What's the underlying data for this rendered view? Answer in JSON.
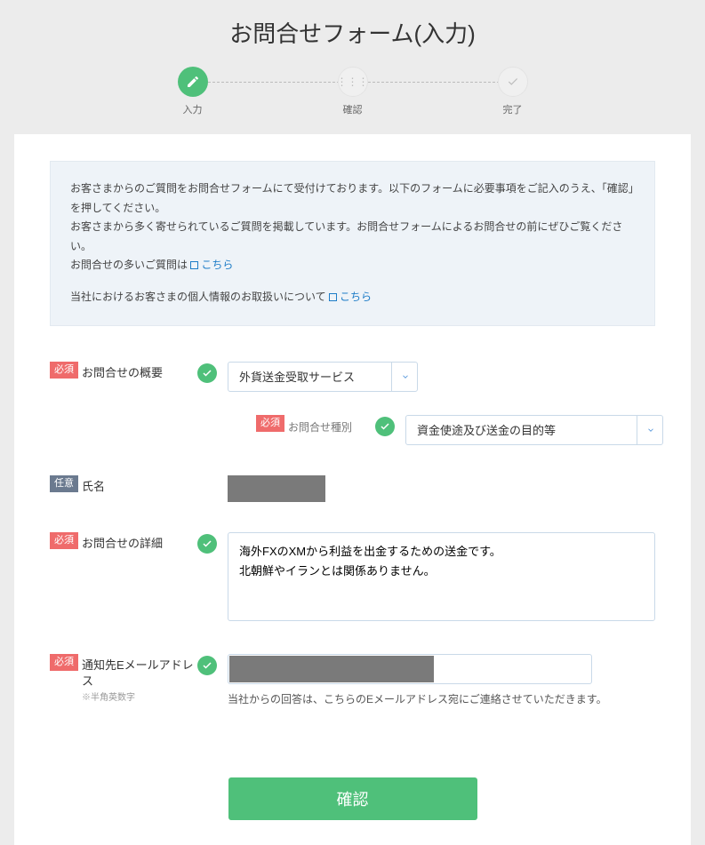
{
  "page": {
    "title": "お問合せフォーム(入力)"
  },
  "progress": {
    "step1": "入力",
    "step2": "確認",
    "step3": "完了"
  },
  "notice": {
    "line1": "お客さまからのご質問をお問合せフォームにて受付けております。以下のフォームに必要事項をご記入のうえ、「確認」を押してください。",
    "line2": "お客さまから多く寄せられているご質問を掲載しています。お問合せフォームによるお問合せの前にぜひご覧ください。",
    "faq_prefix": "お問合せの多いご質問は",
    "faq_link": "こちら",
    "privacy_prefix": "当社におけるお客さまの個人情報のお取扱いについて",
    "privacy_link": "こちら"
  },
  "tags": {
    "required": "必須",
    "optional": "任意"
  },
  "labels": {
    "overview": "お問合せの概要",
    "category": "お問合せ種別",
    "name": "氏名",
    "detail": "お問合せの詳細",
    "email": "通知先Eメールアドレス",
    "email_sub": "※半角英数字"
  },
  "values": {
    "overview": "外貨送金受取サービス",
    "category": "資金使途及び送金の目的等",
    "detail": "海外FXのXMから利益を出金するための送金です。\n北朝鮮やイランとは関係ありません。",
    "name_redacted": true,
    "email_redacted": true
  },
  "email_note": "当社からの回答は、こちらのEメールアドレス宛にご連絡させていただきます。",
  "submit": {
    "label": "確認"
  }
}
